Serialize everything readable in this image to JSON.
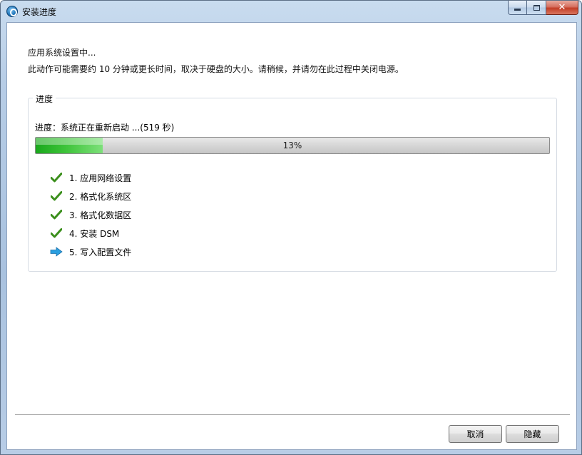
{
  "window": {
    "title": "安装进度",
    "controls": {
      "minimize": "minimize",
      "maximize": "maximize",
      "close": "✕"
    }
  },
  "description": {
    "line1": "应用系统设置中...",
    "line2": "此动作可能需要约 10 分钟或更长时间，取决于硬盘的大小。请稍候，并请勿在此过程中关闭电源。"
  },
  "progress_group": {
    "legend": "进度",
    "status_label": "进度：系统正在重新启动 ...(519 秒)",
    "percent_text": "13%",
    "percent_value": 13,
    "fill_color": "#3ec43a"
  },
  "steps": [
    {
      "label": "1. 应用网络设置",
      "state": "done",
      "icon": "check-icon"
    },
    {
      "label": "2. 格式化系统区",
      "state": "done",
      "icon": "check-icon"
    },
    {
      "label": "3. 格式化数据区",
      "state": "done",
      "icon": "check-icon"
    },
    {
      "label": "4. 安装 DSM",
      "state": "done",
      "icon": "check-icon"
    },
    {
      "label": "5. 写入配置文件",
      "state": "current",
      "icon": "arrow-right-icon"
    }
  ],
  "buttons": {
    "cancel": "取消",
    "hide": "隐藏"
  },
  "colors": {
    "check": "#3b8f1c",
    "arrow": "#2a9fe0"
  }
}
